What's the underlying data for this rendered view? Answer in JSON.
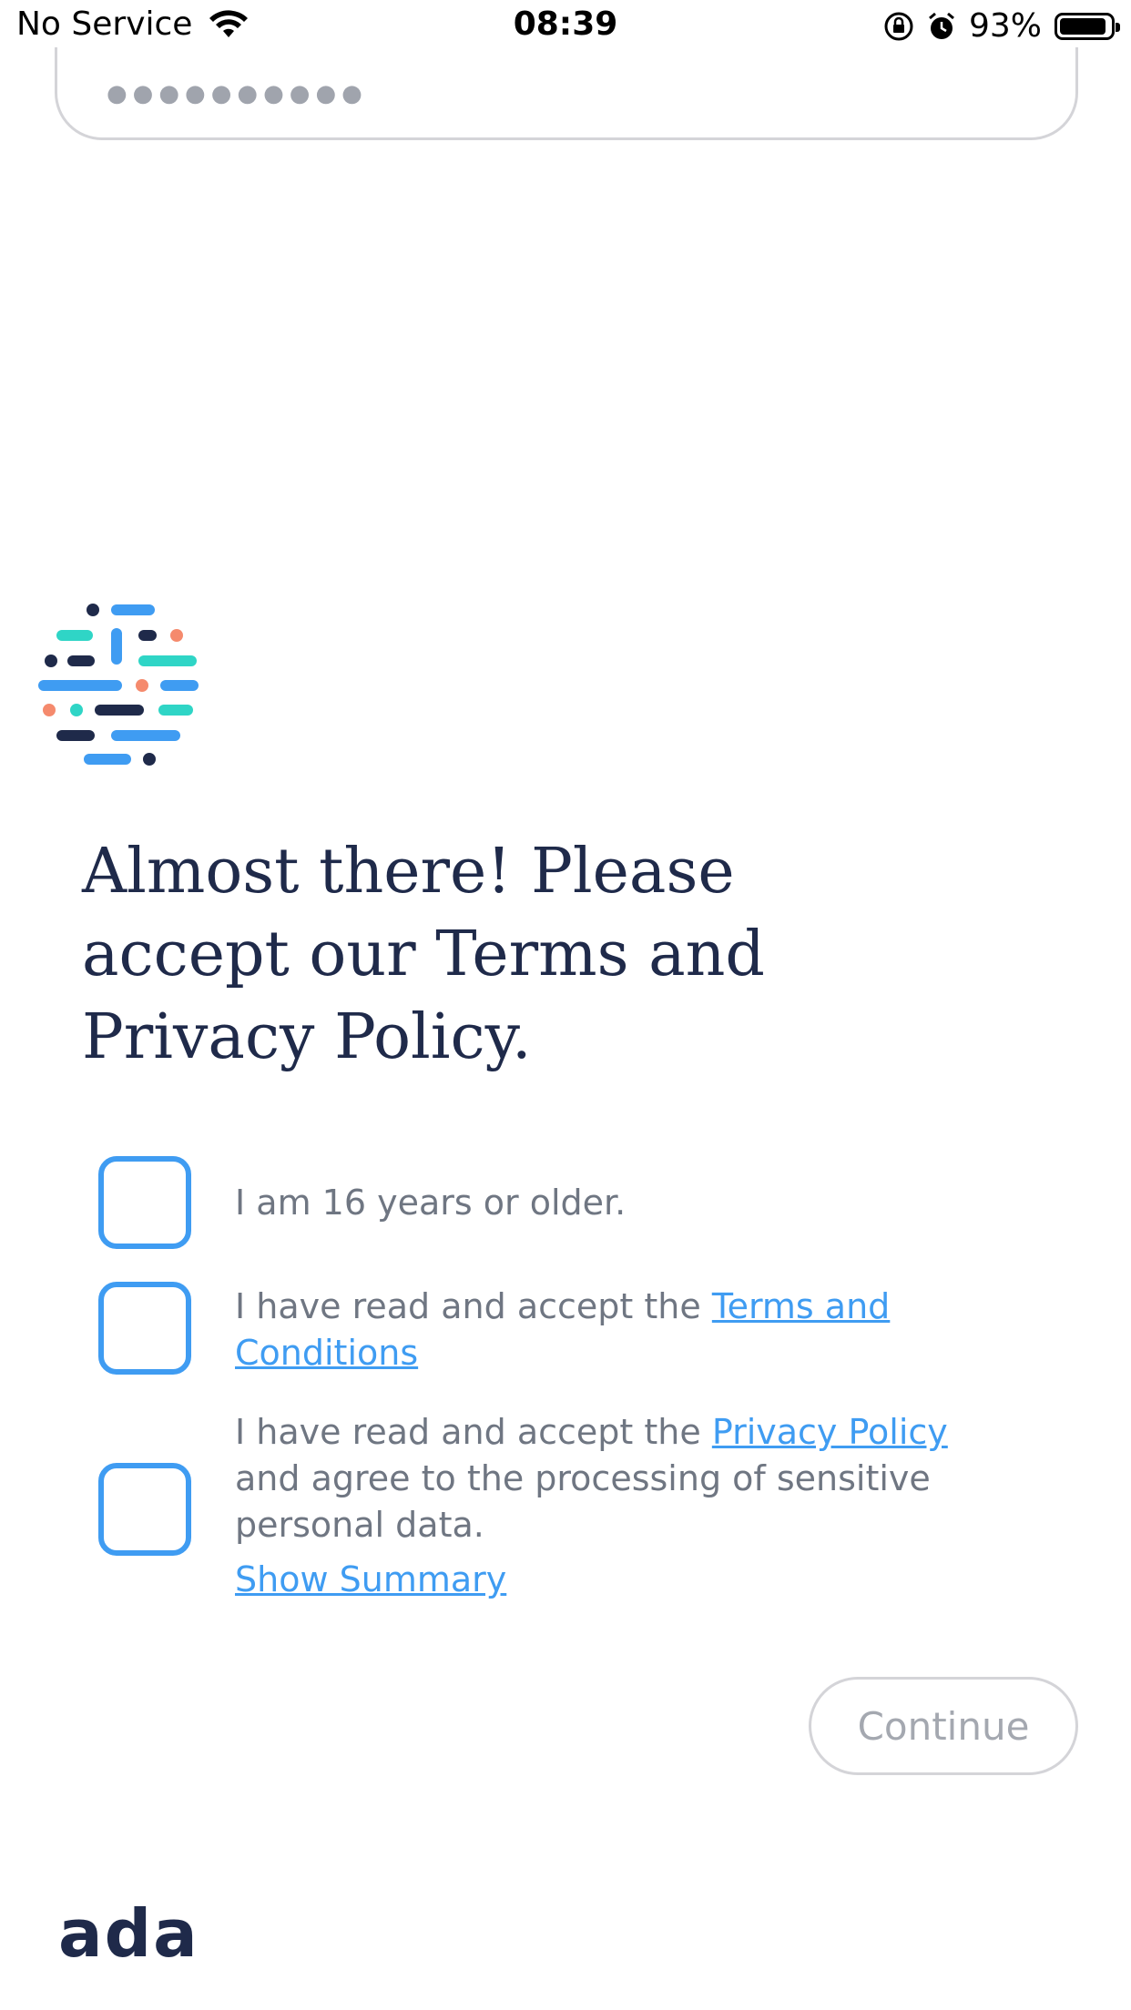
{
  "status_bar": {
    "carrier": "No Service",
    "time": "08:39",
    "battery_percent": "93%",
    "battery_level": 0.93,
    "icons": [
      "wifi-icon",
      "orientation-lock-icon",
      "alarm-icon",
      "battery-icon"
    ]
  },
  "password_field": {
    "masked_value": "●●●●●●●●●●"
  },
  "heading": "Almost there! Please accept our Terms and Privacy Policy.",
  "consents": {
    "age": {
      "text": "I am 16 years or older.",
      "checked": false
    },
    "terms": {
      "prefix": "I have read and accept the ",
      "link": "Terms and Conditions",
      "checked": false
    },
    "privacy": {
      "prefix": "I have read and accept the ",
      "link": "Privacy Policy",
      "suffix": " and agree to the processing of sensitive personal data.",
      "checked": false
    }
  },
  "show_summary": "Show Summary",
  "continue_label": "Continue",
  "brand": "ada",
  "colors": {
    "accent_blue": "#3f9cf2",
    "navy": "#1f2a4a",
    "teal": "#2fd5c6",
    "coral": "#f58a6d",
    "muted_text": "#6f7682"
  }
}
